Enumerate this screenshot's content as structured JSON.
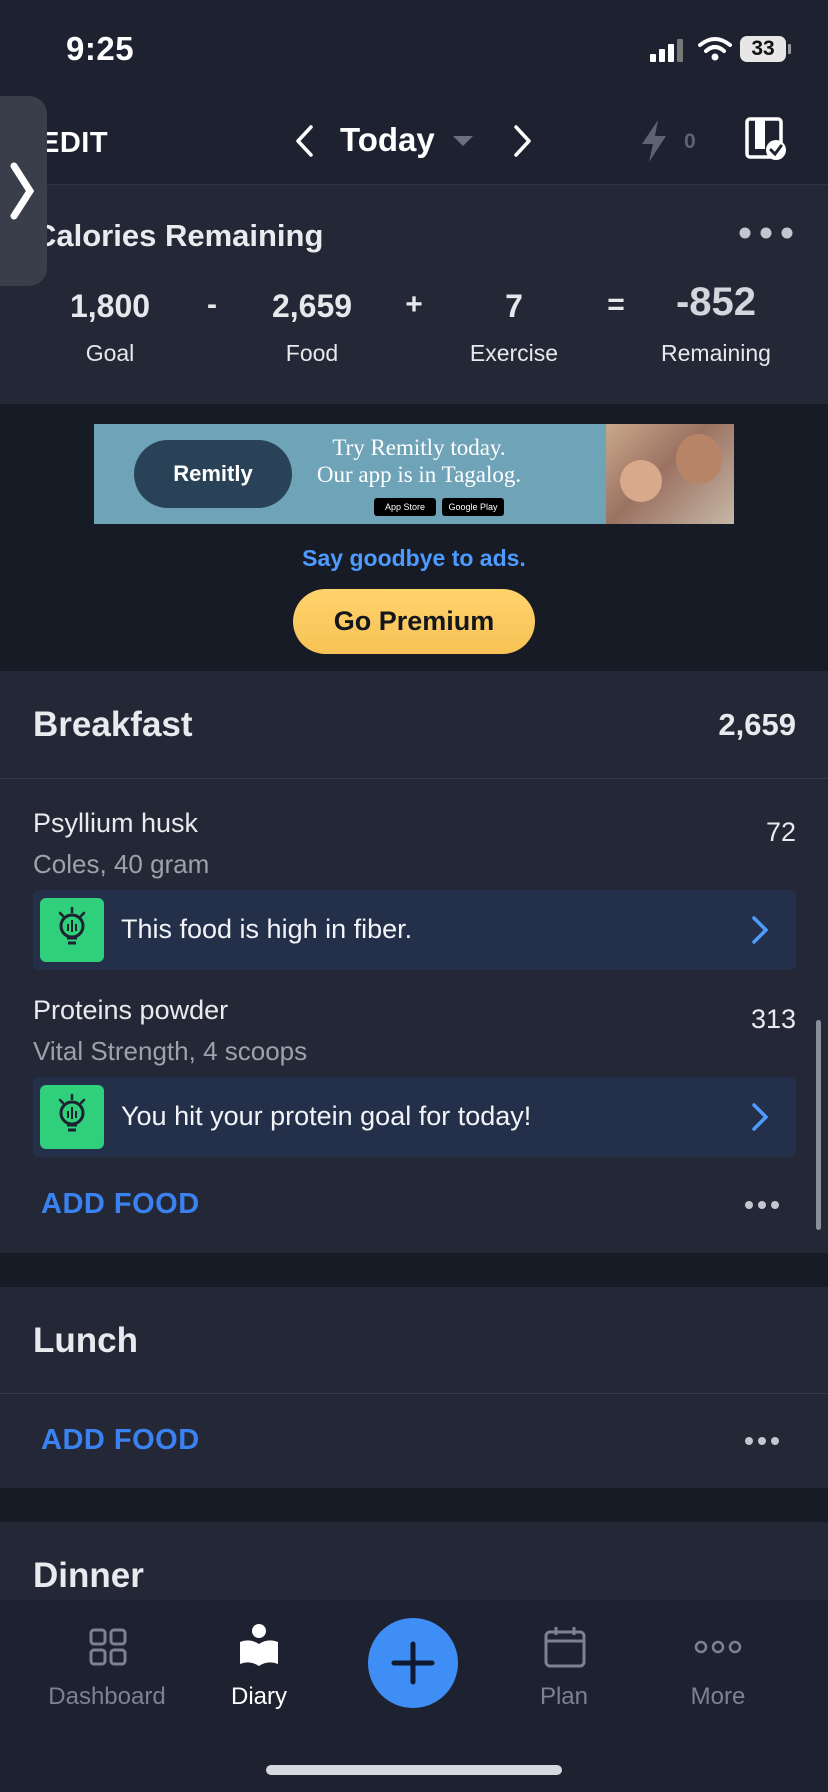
{
  "status_bar": {
    "time": "9:25",
    "battery": "33"
  },
  "header": {
    "edit_label": "EDIT",
    "date_label": "Today",
    "streak_count": "0"
  },
  "calories": {
    "title": "Calories Remaining",
    "goal": {
      "value": "1,800",
      "label": "Goal"
    },
    "minus": "-",
    "food": {
      "value": "2,659",
      "label": "Food"
    },
    "plus": "+",
    "exercise": {
      "value": "7",
      "label": "Exercise"
    },
    "equals": "=",
    "remaining": {
      "value": "-852",
      "label": "Remaining"
    }
  },
  "ad": {
    "brand": "Remitly",
    "line1": "Try Remitly today.",
    "line2": "Our app is in Tagalog.",
    "app_store": "App Store",
    "google_play": "Google Play",
    "goodbye": "Say goodbye to ads.",
    "premium_button": "Go Premium"
  },
  "breakfast": {
    "title": "Breakfast",
    "calories": "2,659",
    "items": [
      {
        "name": "Psyllium husk",
        "detail": "Coles, 40 gram",
        "calories": "72",
        "tip": "This food is high in fiber."
      },
      {
        "name": "Proteins powder",
        "detail": "Vital Strength, 4 scoops",
        "calories": "313",
        "tip": "You hit your protein goal for today!"
      }
    ],
    "add_food": "ADD FOOD"
  },
  "lunch": {
    "title": "Lunch",
    "add_food": "ADD FOOD"
  },
  "dinner": {
    "title": "Dinner"
  },
  "nav": {
    "dashboard": "Dashboard",
    "diary": "Diary",
    "plan": "Plan",
    "more": "More"
  },
  "colors": {
    "background": "#171b26",
    "card": "#242836",
    "accent_blue": "#3e8ef6",
    "premium_yellow": "#f7c256",
    "tip_green": "#2fcf7b"
  }
}
